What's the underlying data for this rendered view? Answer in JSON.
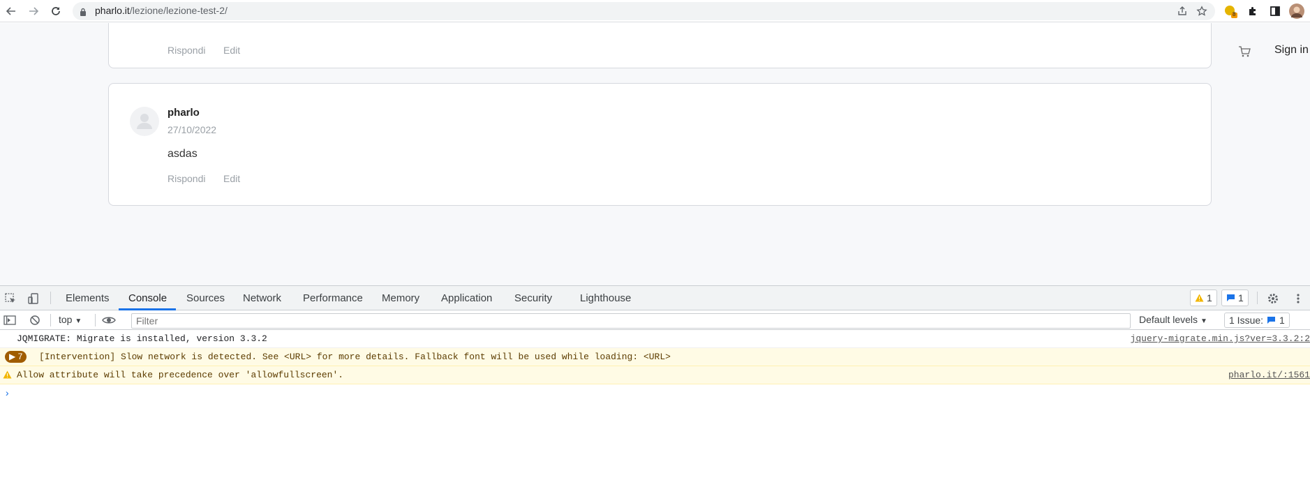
{
  "browser": {
    "url_domain": "pharlo.it",
    "url_path": "/lezione/lezione-test-2/",
    "extension_badge": "8"
  },
  "page": {
    "cart_icon": "cart-icon",
    "signin_label": "Sign in",
    "top_comment": {
      "reply_label": "Rispondi",
      "edit_label": "Edit"
    },
    "comment": {
      "author": "pharlo",
      "date": "27/10/2022",
      "text": "asdas",
      "reply_label": "Rispondi",
      "edit_label": "Edit"
    }
  },
  "devtools": {
    "tabs": [
      "Elements",
      "Console",
      "Sources",
      "Network",
      "Performance",
      "Memory",
      "Application",
      "Security",
      "Lighthouse"
    ],
    "active_tab": "Console",
    "warning_count": "1",
    "message_count": "1",
    "context": "top",
    "filter_placeholder": "Filter",
    "levels_label": "Default levels",
    "issues_label": "1 Issue:",
    "issues_count": "1",
    "logs": [
      {
        "text": "JQMIGRATE: Migrate is installed, version 3.3.2",
        "source": "jquery-migrate.min.js?ver=3.3.2:2",
        "level": "info"
      },
      {
        "badge": "7",
        "text": "[Intervention] Slow network is detected. See <URL> for more details. Fallback font will be used while loading: <URL>",
        "level": "warn"
      },
      {
        "text": "Allow attribute will take precedence over 'allowfullscreen'.",
        "source": "pharlo.it/:1561",
        "level": "warn"
      }
    ]
  },
  "colors": {
    "accent": "#1a73e8",
    "warn_bg": "#fffbe5",
    "badge_bg": "#a05c00"
  }
}
